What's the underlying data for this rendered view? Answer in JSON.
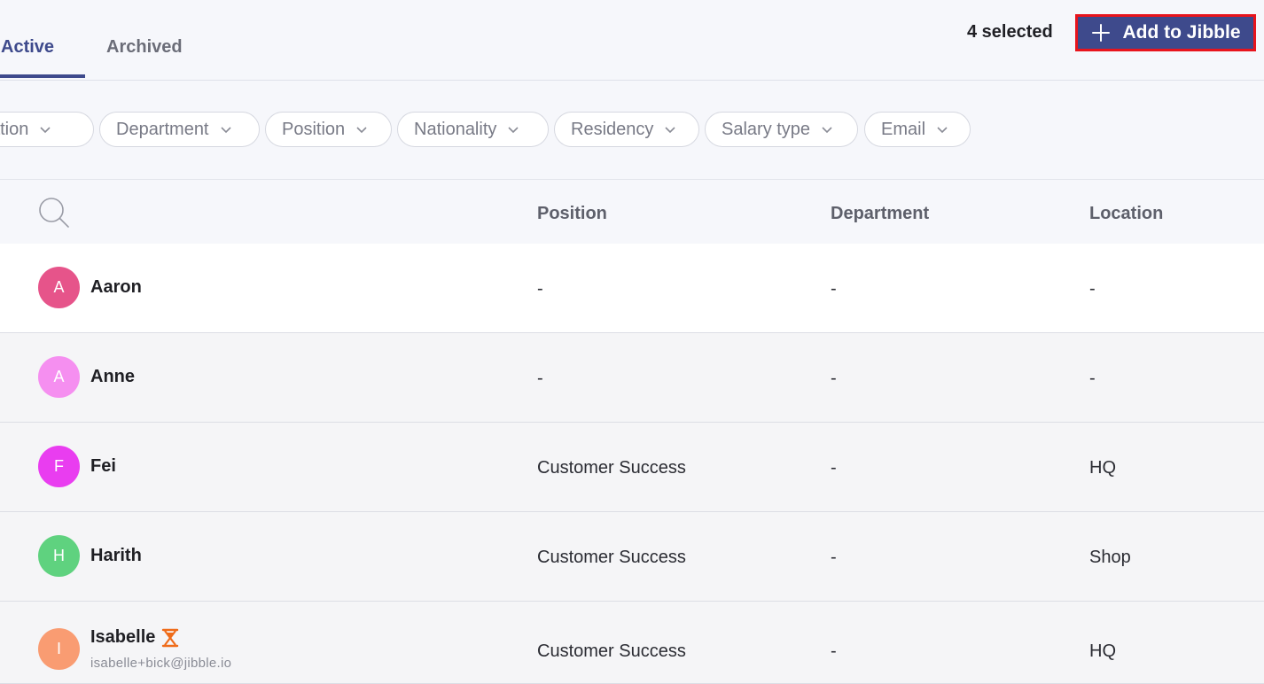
{
  "tabs": [
    {
      "label": "Active",
      "active": true
    },
    {
      "label": "Archived",
      "active": false
    }
  ],
  "toolbar": {
    "selected_count": "4 selected",
    "add_button_label": "Add to Jibble"
  },
  "filters": [
    {
      "label": "cation"
    },
    {
      "label": "Department"
    },
    {
      "label": "Position"
    },
    {
      "label": "Nationality"
    },
    {
      "label": "Residency"
    },
    {
      "label": "Salary type"
    },
    {
      "label": "Email"
    }
  ],
  "table": {
    "columns": {
      "position": "Position",
      "department": "Department",
      "location": "Location"
    },
    "rows": [
      {
        "initial": "A",
        "name": "Aaron",
        "position": "-",
        "department": "-",
        "location": "-",
        "avatar_color": "#e6548a"
      },
      {
        "initial": "A",
        "name": "Anne",
        "position": "-",
        "department": "-",
        "location": "-",
        "avatar_color": "#f58ff0"
      },
      {
        "initial": "F",
        "name": "Fei",
        "position": "Customer Success",
        "department": "-",
        "location": "HQ",
        "avatar_color": "#e93df0"
      },
      {
        "initial": "H",
        "name": "Harith",
        "position": "Customer Success",
        "department": "-",
        "location": "Shop",
        "avatar_color": "#5fd27f"
      },
      {
        "initial": "I",
        "name": "Isabelle",
        "email": "isabelle+bick@jibble.io",
        "position": "Customer Success",
        "department": "-",
        "location": "HQ",
        "avatar_color": "#f99c72"
      }
    ]
  },
  "colors": {
    "accent": "#3e4a8c",
    "highlight_border": "#e8141c",
    "pending_icon": "#ef6c1a"
  },
  "icons": {
    "search": "search-icon",
    "plus": "plus-icon",
    "chevron": "chevron-down-icon",
    "pending": "hourglass-icon"
  }
}
